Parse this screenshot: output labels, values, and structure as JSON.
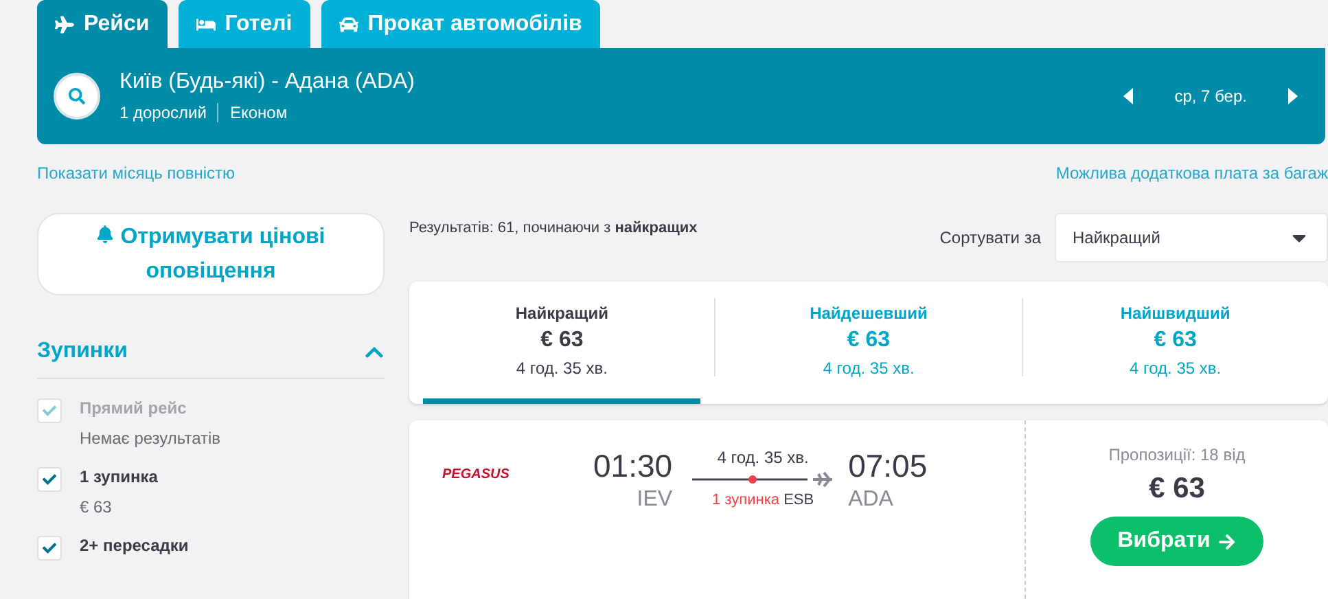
{
  "tabs": [
    {
      "label": "Рейси",
      "kind": "plane",
      "selected": true
    },
    {
      "label": "Готелі",
      "kind": "bed",
      "selected": false
    },
    {
      "label": "Прокат автомобілів",
      "kind": "car",
      "selected": false
    }
  ],
  "search": {
    "route": "Київ (Будь-які) - Адана (ADA)",
    "passengers": "1 дорослий",
    "cabin": "Економ",
    "date": "ср, 7 бер."
  },
  "links": {
    "month": "Показати місяць повністю",
    "baggage": "Можлива додаткова плата за багаж"
  },
  "alert_button": "Отримувати цінові оповіщення",
  "filters": {
    "title": "Зупинки",
    "expanded": true,
    "items": [
      {
        "label": "Прямий рейс",
        "note": "Немає результатів",
        "checked": true,
        "disabled": true
      },
      {
        "label": "1 зупинка",
        "note": "€ 63",
        "checked": true,
        "disabled": false
      },
      {
        "label": "2+ пересадки",
        "checked": true,
        "disabled": false
      }
    ]
  },
  "results_summary": "Результатів: 61, починаючи з **найкращих**",
  "sort": {
    "label": "Сортувати за",
    "value": "Найкращий"
  },
  "sort_tabs": [
    {
      "label": "Найкращий",
      "price": "€ 63",
      "duration": "4 год. 35 хв.",
      "selected": true
    },
    {
      "label": "Найдешевший",
      "price": "€ 63",
      "duration": "4 год. 35 хв.",
      "selected": false
    },
    {
      "label": "Найшвидший",
      "price": "€ 63",
      "duration": "4 год. 35 хв.",
      "selected": false
    }
  ],
  "flight": {
    "airline_logo": "PEGASUS",
    "depart_time": "01:30",
    "depart_code": "IEV",
    "duration": "4 год. 35 хв.",
    "stops": "1 зупинка",
    "stop_code": "ESB",
    "arrive_time": "07:05",
    "arrive_code": "ADA",
    "offers": "Пропозиції: 18 від",
    "price": "€ 63",
    "select": "Вибрати"
  }
}
